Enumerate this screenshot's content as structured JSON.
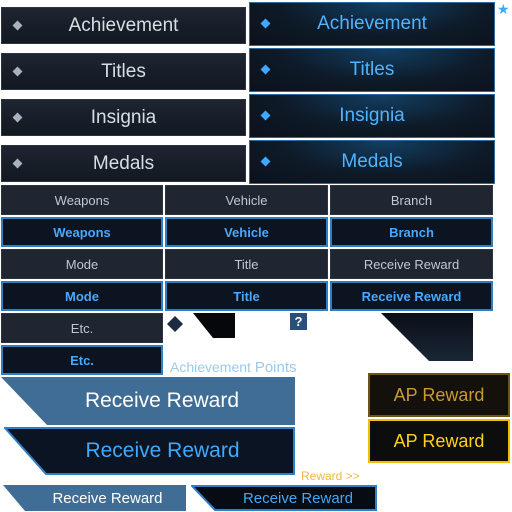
{
  "menu_left": [
    "Achievement",
    "Titles",
    "Insignia",
    "Medals"
  ],
  "menu_right": [
    "Achievement",
    "Titles",
    "Insignia",
    "Medals"
  ],
  "star_icon": "★",
  "tabs": {
    "row1_off": [
      "Weapons",
      "Vehicle",
      "Branch"
    ],
    "row1_on": [
      "Weapons",
      "Vehicle",
      "Branch"
    ],
    "row2_off": [
      "Mode",
      "Title",
      "Receive Reward"
    ],
    "row2_on": [
      "Mode",
      "Title",
      "Receive Reward"
    ],
    "etc_off": "Etc.",
    "etc_on": "Etc."
  },
  "help_icon": "?",
  "ap_label": {
    "word1": "Achievement",
    "word2": "Points"
  },
  "receive_reward": {
    "large_off": "Receive Reward",
    "large_on": "Receive Reward",
    "small_off": "Receive Reward",
    "small_on": "Receive Reward"
  },
  "ap_reward": {
    "off": "AP Reward",
    "on": "AP Reward"
  },
  "reward_link": "Reward >>",
  "colors": {
    "accent_blue": "#3fa9ff",
    "dark_panel": "#1e2531",
    "gold": "#f0c000"
  }
}
